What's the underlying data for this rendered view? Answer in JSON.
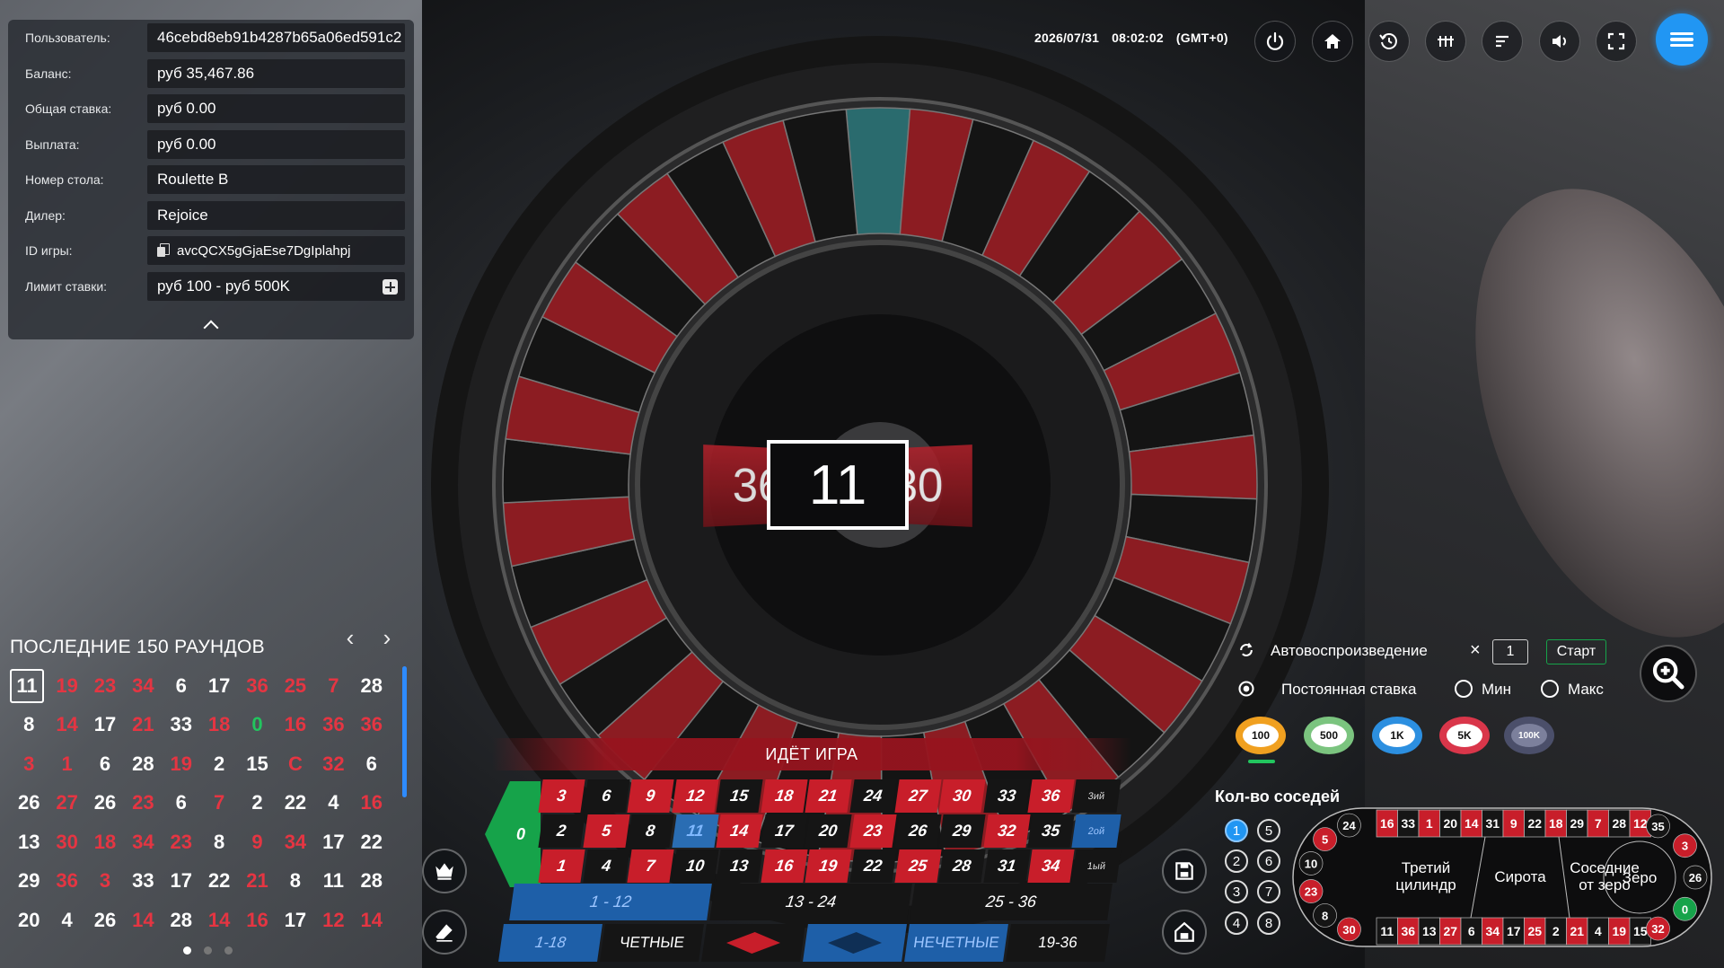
{
  "info": {
    "user_label": "Пользователь:",
    "user_value": "46cebd8eb91b4287b65a06ed591c2",
    "balance_label": "Баланс:",
    "balance_value": "руб 35,467.86",
    "total_bet_label": "Общая ставка:",
    "total_bet_value": "руб 0.00",
    "payout_label": "Выплата:",
    "payout_value": "руб 0.00",
    "table_label": "Номер стола:",
    "table_value": "Roulette B",
    "dealer_label": "Дилер:",
    "dealer_value": "Rejoice",
    "game_id_label": "ID игры:",
    "game_id_value": "avcQCX5gGjaEse7DgIplahpj",
    "limit_label": "Лимит ставки:",
    "limit_value": "руб 100 - руб 500K"
  },
  "topbar": {
    "date": "2026/07/31",
    "time": "08:02:02",
    "tz": "(GMT+0)",
    "icons": [
      "power-icon",
      "home-icon",
      "history-icon",
      "road-icon",
      "stats-icon",
      "sound-icon",
      "fullscreen-icon",
      "menu-icon"
    ]
  },
  "result": {
    "prev": "36",
    "current": "11",
    "next": "30"
  },
  "history": {
    "title": "ПОСЛЕДНИЕ 150 РАУНДОВ",
    "rows": [
      [
        [
          "11",
          "black"
        ],
        [
          "19",
          "red"
        ],
        [
          "23",
          "red"
        ],
        [
          "34",
          "red"
        ],
        [
          "6",
          "black"
        ],
        [
          "17",
          "black"
        ],
        [
          "36",
          "red"
        ],
        [
          "25",
          "red"
        ],
        [
          "7",
          "red"
        ],
        [
          "28",
          "black"
        ]
      ],
      [
        [
          "8",
          "black"
        ],
        [
          "14",
          "red"
        ],
        [
          "17",
          "black"
        ],
        [
          "21",
          "red"
        ],
        [
          "33",
          "black"
        ],
        [
          "18",
          "red"
        ],
        [
          "0",
          "green"
        ],
        [
          "16",
          "red"
        ],
        [
          "36",
          "red"
        ],
        [
          "36",
          "red"
        ]
      ],
      [
        [
          "3",
          "red"
        ],
        [
          "1",
          "red"
        ],
        [
          "6",
          "black"
        ],
        [
          "28",
          "black"
        ],
        [
          "19",
          "red"
        ],
        [
          "2",
          "black"
        ],
        [
          "15",
          "black"
        ],
        [
          "C",
          "red"
        ],
        [
          "32",
          "red"
        ],
        [
          "6",
          "black"
        ]
      ],
      [
        [
          "26",
          "black"
        ],
        [
          "27",
          "red"
        ],
        [
          "26",
          "black"
        ],
        [
          "23",
          "red"
        ],
        [
          "6",
          "black"
        ],
        [
          "7",
          "red"
        ],
        [
          "2",
          "black"
        ],
        [
          "22",
          "black"
        ],
        [
          "4",
          "black"
        ],
        [
          "16",
          "red"
        ]
      ],
      [
        [
          "13",
          "black"
        ],
        [
          "30",
          "red"
        ],
        [
          "18",
          "red"
        ],
        [
          "34",
          "red"
        ],
        [
          "23",
          "red"
        ],
        [
          "8",
          "black"
        ],
        [
          "9",
          "red"
        ],
        [
          "34",
          "red"
        ],
        [
          "17",
          "black"
        ],
        [
          "22",
          "black"
        ]
      ],
      [
        [
          "29",
          "black"
        ],
        [
          "36",
          "red"
        ],
        [
          "3",
          "red"
        ],
        [
          "33",
          "black"
        ],
        [
          "17",
          "black"
        ],
        [
          "22",
          "black"
        ],
        [
          "21",
          "red"
        ],
        [
          "8",
          "black"
        ],
        [
          "11",
          "black"
        ],
        [
          "28",
          "black"
        ]
      ],
      [
        [
          "20",
          "black"
        ],
        [
          "4",
          "black"
        ],
        [
          "26",
          "black"
        ],
        [
          "14",
          "red"
        ],
        [
          "28",
          "black"
        ],
        [
          "14",
          "red"
        ],
        [
          "16",
          "red"
        ],
        [
          "17",
          "black"
        ],
        [
          "12",
          "red"
        ],
        [
          "14",
          "red"
        ]
      ]
    ]
  },
  "status": "ИДЁТ ИГРА",
  "table": {
    "zero": "0",
    "rows": [
      [
        [
          "3",
          "red"
        ],
        [
          "6",
          "black"
        ],
        [
          "9",
          "red"
        ],
        [
          "12",
          "red"
        ],
        [
          "15",
          "black"
        ],
        [
          "18",
          "red"
        ],
        [
          "21",
          "red"
        ],
        [
          "24",
          "black"
        ],
        [
          "27",
          "red"
        ],
        [
          "30",
          "red"
        ],
        [
          "33",
          "black"
        ],
        [
          "36",
          "red"
        ]
      ],
      [
        [
          "2",
          "black"
        ],
        [
          "5",
          "red"
        ],
        [
          "8",
          "black"
        ],
        [
          "11",
          "hl"
        ],
        [
          "14",
          "red"
        ],
        [
          "17",
          "black"
        ],
        [
          "20",
          "black"
        ],
        [
          "23",
          "red"
        ],
        [
          "26",
          "black"
        ],
        [
          "29",
          "black"
        ],
        [
          "32",
          "red"
        ],
        [
          "35",
          "black"
        ]
      ],
      [
        [
          "1",
          "red"
        ],
        [
          "4",
          "black"
        ],
        [
          "7",
          "red"
        ],
        [
          "10",
          "black"
        ],
        [
          "13",
          "black"
        ],
        [
          "16",
          "red"
        ],
        [
          "19",
          "red"
        ],
        [
          "22",
          "black"
        ],
        [
          "25",
          "red"
        ],
        [
          "28",
          "black"
        ],
        [
          "31",
          "black"
        ],
        [
          "34",
          "red"
        ]
      ]
    ],
    "columns": [
      "3ий",
      "2ой",
      "1ый"
    ],
    "dozens": [
      "1 - 12",
      "13 - 24",
      "25 - 36"
    ],
    "evens": {
      "low": "1-18",
      "even": "ЧЕТНЫЕ",
      "odd": "НЕЧЕТНЫЕ",
      "high": "19-36"
    }
  },
  "controls": {
    "autoplay": "Автовоспроизведение",
    "autoplay_x": "×",
    "autoplay_count": "1",
    "start": "Старт",
    "constant_bet": "Постоянная ставка",
    "min": "Мин",
    "max": "Макс"
  },
  "chips": [
    "100",
    "500",
    "1K",
    "5K",
    "100K"
  ],
  "neighbors": {
    "title": "Кол-во соседей",
    "values": [
      "1",
      "5",
      "2",
      "6",
      "3",
      "7",
      "4",
      "8"
    ]
  },
  "racetrack": {
    "top": [
      "16",
      "33",
      "1",
      "20",
      "14",
      "31",
      "9",
      "22",
      "18",
      "29",
      "7",
      "28",
      "12"
    ],
    "bottom": [
      "11",
      "36",
      "13",
      "27",
      "6",
      "34",
      "17",
      "25",
      "2",
      "21",
      "4",
      "19",
      "15"
    ],
    "left": [
      "24",
      "5",
      "10",
      "23",
      "8",
      "30"
    ],
    "right": [
      "35",
      "3",
      "26",
      "0",
      "32"
    ],
    "sections": [
      "Третий цилиндр",
      "Сирота",
      "Соседние от зеро",
      "Зеро"
    ],
    "reds": [
      "1",
      "3",
      "5",
      "7",
      "9",
      "12",
      "14",
      "16",
      "18",
      "19",
      "21",
      "23",
      "25",
      "27",
      "30",
      "32",
      "34",
      "36"
    ]
  }
}
